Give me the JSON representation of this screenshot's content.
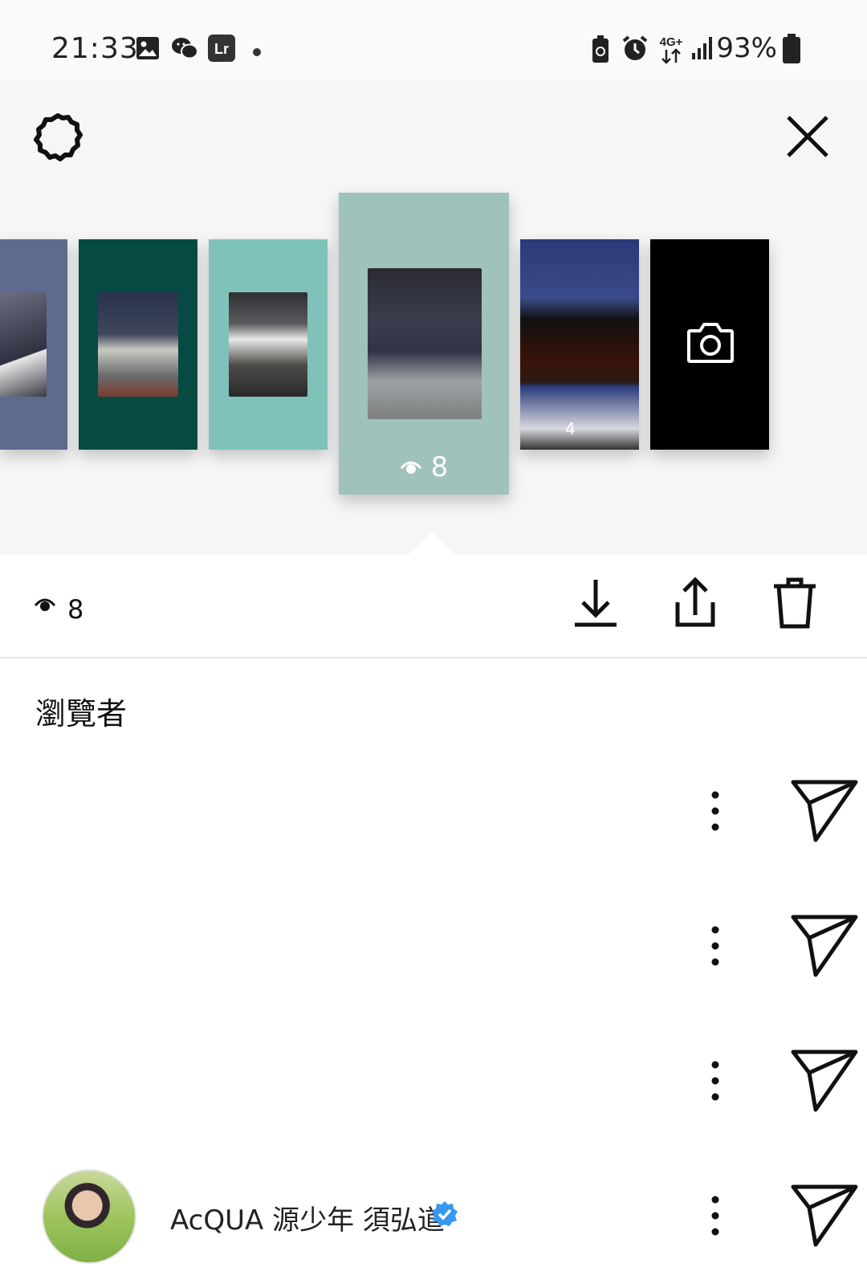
{
  "status_bar": {
    "time": "21:33",
    "network": "4G+",
    "battery_percent": "93%",
    "icons": [
      "gallery-icon",
      "wechat-icon",
      "lightroom-icon",
      "dot-icon",
      "battery-saver-icon",
      "alarm-icon",
      "network-4g-icon",
      "signal-icon",
      "battery-icon"
    ],
    "lr_label": "Lr"
  },
  "header": {
    "settings_icon": "gear-icon",
    "close_icon": "close-icon"
  },
  "story_tray": {
    "cards": [
      {
        "name": "story-card-1",
        "bg": "#5f6a8f",
        "photo": "#3b3e50"
      },
      {
        "name": "story-card-2",
        "bg": "#054a43",
        "photo": "#5b5d63"
      },
      {
        "name": "story-card-3",
        "bg": "#7fc2ba",
        "photo": "#6a6a6c"
      },
      {
        "name": "story-card-4",
        "bg": "#9fc2bb",
        "photo": "#3c3f4e",
        "selected": true,
        "views": "8"
      },
      {
        "name": "story-card-5",
        "bg": "#2a3a78",
        "overlay_count": "4"
      },
      {
        "name": "story-card-camera",
        "bg": "#000000"
      }
    ]
  },
  "actions": {
    "view_count": "8",
    "download_icon": "download-icon",
    "share_icon": "share-icon",
    "delete_icon": "trash-icon"
  },
  "viewers": {
    "title": "瀏覽者",
    "rows": [
      {
        "username": ""
      },
      {
        "username": ""
      },
      {
        "username": ""
      },
      {
        "username": "AcQUA 源少年 須弘道",
        "verified": true
      }
    ]
  },
  "colors": {
    "verified_blue": "#3897f0",
    "selected_card": "#9fc2bb"
  }
}
